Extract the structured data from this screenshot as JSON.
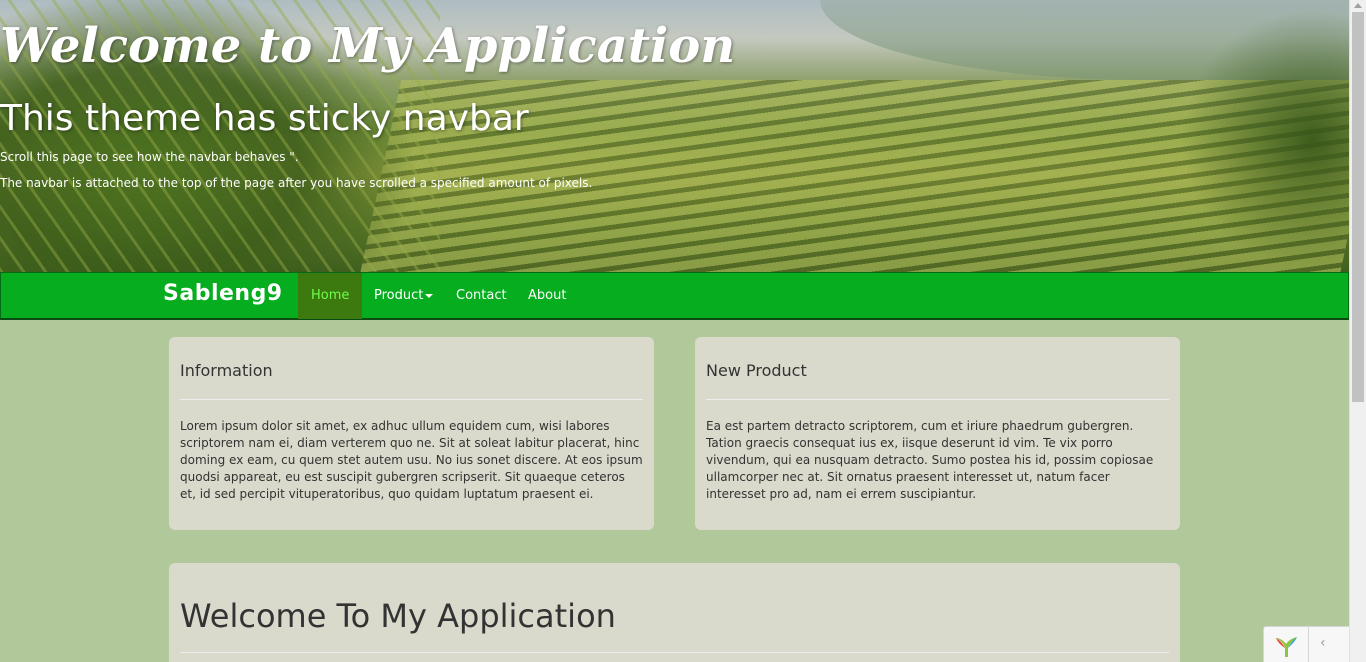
{
  "hero": {
    "title": "Welcome to My Application",
    "subtitle": "This theme has sticky navbar",
    "line1": "Scroll this page to see how the navbar behaves \".",
    "line2": "The navbar is attached to the top of the page after you have scrolled a specified amount of pixels."
  },
  "navbar": {
    "brand": "Sableng9",
    "items": [
      {
        "label": "Home",
        "active": true
      },
      {
        "label": "Product",
        "dropdown": true
      },
      {
        "label": "Contact"
      },
      {
        "label": "About"
      }
    ],
    "colors": {
      "background": "#05ad1f",
      "active_bg": "#3c7a10",
      "active_text": "#6cff4a"
    }
  },
  "panels": {
    "information": {
      "title": "Information",
      "body": "Lorem ipsum dolor sit amet, ex adhuc ullum equidem cum, wisi labores scriptorem nam ei, diam verterem quo ne. Sit at soleat labitur placerat, hinc doming ex eam, cu quem stet autem usu. No ius sonet discere. At eos ipsum quodsi appareat, eu est suscipit gubergren scripserit. Sit quaeque ceteros et, id sed percipit vituperatoribus, quo quidam luptatum praesent ei."
    },
    "new_product": {
      "title": "New Product",
      "body": "Ea est partem detracto scriptorem, cum et iriure phaedrum gubergren. Tation graecis consequat ius ex, iisque deserunt id vim. Te vix porro vivendum, qui ea nusquam detracto. Sumo postea his id, possim copiosae ullamcorper nec at. Sit ornatus praesent interesset ut, natum facer interesset pro ad, nam ei errem suscipiantur."
    },
    "welcome": {
      "title": "Welcome To My Application"
    }
  },
  "debug": {
    "logo_icon": "yii-logo-icon",
    "toggle": "‹"
  },
  "colors": {
    "page_background": "#b1c89b",
    "panel_background": "#d9d9cc"
  }
}
